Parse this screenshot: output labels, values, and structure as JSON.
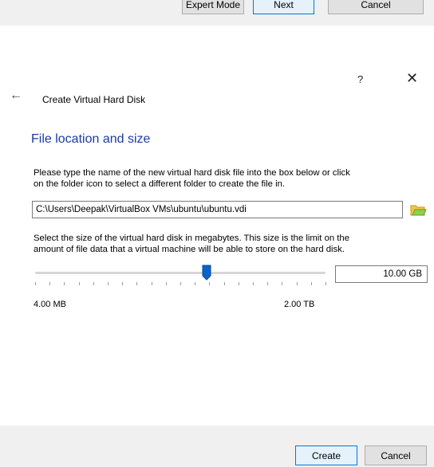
{
  "previous_dialog": {
    "expert_mode_label": "Expert Mode",
    "next_label": "Next",
    "cancel_label": "Cancel"
  },
  "titlebar": {
    "help_label": "?",
    "close_label": "✕"
  },
  "wizard": {
    "title": "Create Virtual Hard Disk",
    "section_title": "File location and size",
    "location_description_line1": "Please type the name of the new virtual hard disk file into the box below or click",
    "location_description_line2": "on the folder icon to select a different folder to create the file in.",
    "file_path": "C:\\Users\\Deepak\\VirtualBox VMs\\ubuntu\\ubuntu.vdi",
    "size_description_line1": "Select the size of the virtual hard disk in megabytes. This size is the limit on the",
    "size_description_line2": "amount of file data that a virtual machine will be able to store on the hard disk.",
    "size_value": "10.00 GB",
    "min_label": "4.00 MB",
    "max_label": "2.00 TB"
  },
  "footer": {
    "create_label": "Create",
    "cancel_label": "Cancel"
  },
  "colors": {
    "section_title": "#1a3aa0",
    "slider_thumb": "#0a64c8",
    "focus_border": "#0078d7"
  }
}
